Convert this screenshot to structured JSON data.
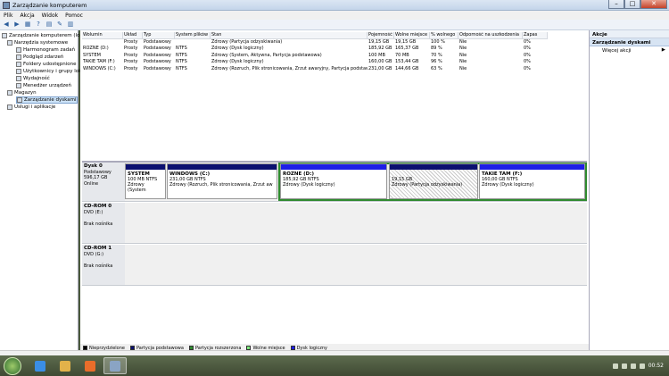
{
  "window": {
    "title": "Zarządzanie komputerem",
    "buttons": {
      "minimize": "–",
      "maximize": "□",
      "close": "✕"
    }
  },
  "menu": [
    "Plik",
    "Akcja",
    "Widok",
    "Pomoc"
  ],
  "toolbar": [
    "◀",
    "▶",
    "▦",
    "?",
    "▤",
    "✎",
    "▥"
  ],
  "tree": {
    "root": "Zarządzanie komputerem (lokal",
    "nodes": [
      {
        "label": "Narzędzia systemowe",
        "indent": 1
      },
      {
        "label": "Harmonogram zadań",
        "indent": 2
      },
      {
        "label": "Podgląd zdarzeń",
        "indent": 2
      },
      {
        "label": "Foldery udostępnione",
        "indent": 2
      },
      {
        "label": "Użytkownicy i grupy lokalne",
        "indent": 2
      },
      {
        "label": "Wydajność",
        "indent": 2
      },
      {
        "label": "Menedżer urządzeń",
        "indent": 2
      },
      {
        "label": "Magazyn",
        "indent": 1
      },
      {
        "label": "Zarządzanie dyskami",
        "indent": 2,
        "selected": true
      },
      {
        "label": "Usługi i aplikacje",
        "indent": 1
      }
    ]
  },
  "volumes": {
    "columns": [
      "Wolumin",
      "Układ",
      "Typ",
      "System plików",
      "Stan",
      "Pojemność",
      "Wolne miejsce",
      "% wolnego",
      "Odporność na uszkodzenia",
      "Zapas"
    ],
    "rows": [
      [
        "",
        "Prosty",
        "Podstawowy",
        "",
        "Zdrowy (Partycja odzyskiwania)",
        "19,15 GB",
        "19,15 GB",
        "100 %",
        "Nie",
        "0%"
      ],
      [
        "ROZNE (D:)",
        "Prosty",
        "Podstawowy",
        "NTFS",
        "Zdrowy (Dysk logiczny)",
        "185,92 GB",
        "165,37 GB",
        "89 %",
        "Nie",
        "0%"
      ],
      [
        "SYSTEM",
        "Prosty",
        "Podstawowy",
        "NTFS",
        "Zdrowy (System, Aktywna, Partycja podstawowa)",
        "100 MB",
        "70 MB",
        "70 %",
        "Nie",
        "0%"
      ],
      [
        "TAKIE TAM (F:)",
        "Prosty",
        "Podstawowy",
        "NTFS",
        "Zdrowy (Dysk logiczny)",
        "160,00 GB",
        "153,44 GB",
        "96 %",
        "Nie",
        "0%"
      ],
      [
        "WINDOWS (C:)",
        "Prosty",
        "Podstawowy",
        "NTFS",
        "Zdrowy (Rozruch, Plik stronicowania, Zrzut awaryjny, Partycja podstawowa)",
        "231,00 GB",
        "144,66 GB",
        "63 %",
        "Nie",
        "0%"
      ]
    ]
  },
  "disks": [
    {
      "name": "Dysk 0",
      "type": "Podstawowy",
      "size": "596,17 GB",
      "status": "Online",
      "partitions": [
        {
          "label": "SYSTEM",
          "size": "100 MB NTFS",
          "status": "Zdrowy (System",
          "color": "#0b1070"
        },
        {
          "label": "WINDOWS (C:)",
          "size": "231,00 GB NTFS",
          "status": "Zdrowy (Rozruch, Plik stronicowania, Zrzut aw",
          "color": "#0b1070"
        },
        {
          "label": "ROZNE (D:)",
          "size": "185,92 GB NTFS",
          "status": "Zdrowy (Dysk logiczny)",
          "color": "#1e1ee6"
        },
        {
          "label": "",
          "size": "19,15 GB",
          "status": "Zdrowy (Partycja odzyskiwania)",
          "color": "#0b1070"
        },
        {
          "label": "TAKIE TAM (F:)",
          "size": "160,00 GB NTFS",
          "status": "Zdrowy (Dysk logiczny)",
          "color": "#1e1ee6"
        }
      ]
    },
    {
      "name": "CD-ROM 0",
      "type": "DVD (E:)",
      "size": "",
      "status": "Brak nośnika"
    },
    {
      "name": "CD-ROM 1",
      "type": "DVD (G:)",
      "size": "",
      "status": "Brak nośnika"
    }
  ],
  "legend": [
    {
      "label": "Nieprzydzielone",
      "color": "#000000"
    },
    {
      "label": "Partycja podstawowa",
      "color": "#0b1070"
    },
    {
      "label": "Partycja rozszerzona",
      "color": "#2f8a2f"
    },
    {
      "label": "Wolne miejsce",
      "color": "#7de87d"
    },
    {
      "label": "Dysk logiczny",
      "color": "#1e1ee6"
    }
  ],
  "actions": {
    "header": "Akcje",
    "section": "Zarządzanie dyskami",
    "items": [
      {
        "label": "Więcej akcji",
        "arrow": "▶"
      }
    ]
  },
  "taskbar": {
    "apps": [
      {
        "name": "explorer-ie",
        "color": "#3a8ee6"
      },
      {
        "name": "folder",
        "color": "#e2b24a"
      },
      {
        "name": "media",
        "color": "#e96d2a"
      },
      {
        "name": "computer-management",
        "color": "#8aa4c4",
        "active": true
      }
    ],
    "clock": "00:52"
  }
}
